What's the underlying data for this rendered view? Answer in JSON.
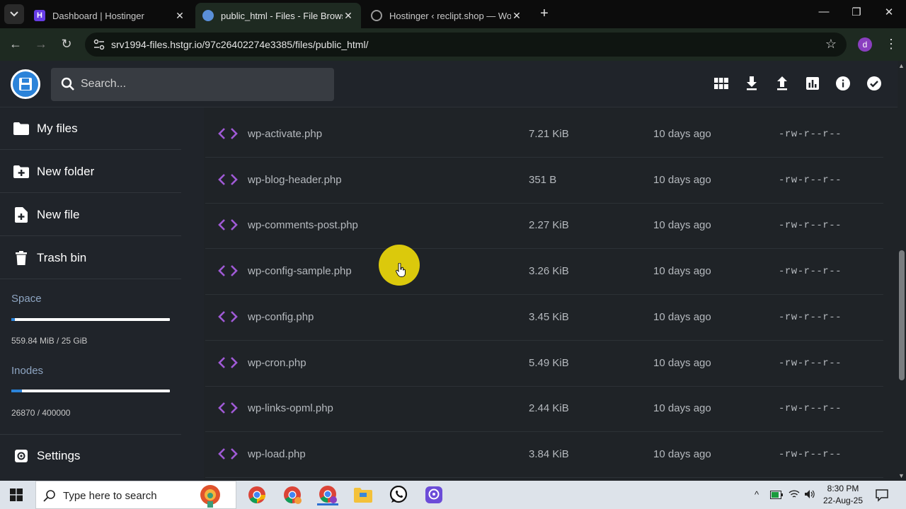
{
  "browser": {
    "tabs": [
      {
        "title": "Dashboard | Hostinger",
        "favicon": "hostinger-icon"
      },
      {
        "title": "public_html - Files - File Browser",
        "favicon": "globe-icon"
      },
      {
        "title": "Hostinger ‹ reclipt.shop — WordPress",
        "favicon": "globe-icon"
      }
    ],
    "url": "srv1994-files.hstgr.io/97c26402274e3385/files/public_html/",
    "profile_initial": "d"
  },
  "header": {
    "search_placeholder": "Search...",
    "actions": [
      "grid-view-icon",
      "download-icon",
      "upload-icon",
      "chart-icon",
      "info-icon",
      "check-circle-icon"
    ]
  },
  "sidebar": {
    "items": [
      {
        "label": "My files",
        "icon": "folder-icon"
      },
      {
        "label": "New folder",
        "icon": "new-folder-icon"
      },
      {
        "label": "New file",
        "icon": "new-file-icon"
      },
      {
        "label": "Trash bin",
        "icon": "trash-icon"
      }
    ],
    "space": {
      "label": "Space",
      "value": "559.84 MiB / 25 GiB",
      "fraction": 0.022
    },
    "inodes": {
      "label": "Inodes",
      "value": "26870 / 400000",
      "fraction": 0.067
    },
    "settings": {
      "label": "Settings",
      "icon": "gear-icon"
    }
  },
  "files": [
    {
      "name": "wp-activate.php",
      "size": "7.21 KiB",
      "modified": "10 days ago",
      "perms": "-rw-r--r--"
    },
    {
      "name": "wp-blog-header.php",
      "size": "351 B",
      "modified": "10 days ago",
      "perms": "-rw-r--r--"
    },
    {
      "name": "wp-comments-post.php",
      "size": "2.27 KiB",
      "modified": "10 days ago",
      "perms": "-rw-r--r--"
    },
    {
      "name": "wp-config-sample.php",
      "size": "3.26 KiB",
      "modified": "10 days ago",
      "perms": "-rw-r--r--"
    },
    {
      "name": "wp-config.php",
      "size": "3.45 KiB",
      "modified": "10 days ago",
      "perms": "-rw-r--r--"
    },
    {
      "name": "wp-cron.php",
      "size": "5.49 KiB",
      "modified": "10 days ago",
      "perms": "-rw-r--r--"
    },
    {
      "name": "wp-links-opml.php",
      "size": "2.44 KiB",
      "modified": "10 days ago",
      "perms": "-rw-r--r--"
    },
    {
      "name": "wp-load.php",
      "size": "3.84 KiB",
      "modified": "10 days ago",
      "perms": "-rw-r--r--"
    }
  ],
  "taskbar": {
    "search_placeholder": "Type here to search",
    "time": "8:30 PM",
    "date": "22-Aug-25"
  },
  "colors": {
    "accent": "#2b83d9",
    "code_icon": "#a05ad6",
    "cursor_highlight": "#f0dc0a"
  }
}
